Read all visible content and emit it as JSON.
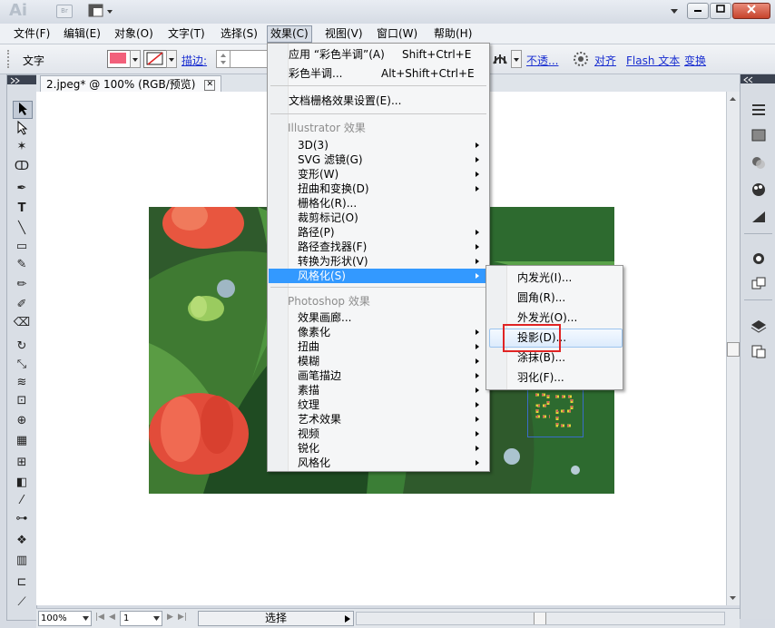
{
  "app": {
    "logo": "Ai",
    "bridge_label": "Br"
  },
  "menubar": {
    "items": [
      "文件(F)",
      "编辑(E)",
      "对象(O)",
      "文字(T)",
      "选择(S)",
      "效果(C)",
      "视图(V)",
      "窗口(W)",
      "帮助(H)"
    ],
    "active": "效果(C)"
  },
  "controlbar": {
    "type_label": "文字",
    "stroke_label": "描边:",
    "opacity_link": "不透...",
    "align_link": "对齐",
    "flash_text_link": "Flash 文本",
    "transform_link": "变换",
    "fill_color": "#f2607b"
  },
  "document_tab": {
    "title": "2.jpeg* @ 100% (RGB/预览)"
  },
  "effect_menu": {
    "apply_label": "应用 “彩色半调”(A)",
    "apply_shortcut": "Shift+Ctrl+E",
    "halftone_label": "彩色半调...",
    "halftone_shortcut": "Alt+Shift+Ctrl+E",
    "raster_settings_label": "文档栅格效果设置(E)...",
    "illustrator_header": "Illustrator 效果",
    "illustrator_items": [
      "3D(3)",
      "SVG 滤镜(G)",
      "变形(W)",
      "扭曲和变换(D)",
      "栅格化(R)...",
      "裁剪标记(O)",
      "路径(P)",
      "路径查找器(F)",
      "转换为形状(V)",
      "风格化(S)"
    ],
    "photoshop_header": "Photoshop 效果",
    "photoshop_items": [
      "效果画廊...",
      "像素化",
      "扭曲",
      "模糊",
      "画笔描边",
      "素描",
      "纹理",
      "艺术效果",
      "视频",
      "锐化",
      "风格化"
    ]
  },
  "stylize_submenu": {
    "items": [
      "内发光(I)...",
      "圆角(R)...",
      "外发光(O)...",
      "投影(D)...",
      "涂抹(B)...",
      "羽化(F)..."
    ],
    "highlighted": "投影(D)..."
  },
  "statusbar": {
    "zoom": "100%",
    "page": "1",
    "tool_label": "选择"
  },
  "colors": {
    "menu_highlight": "#3399ff",
    "annotation_red": "#e02424",
    "link_blue": "#1a2fd1"
  }
}
